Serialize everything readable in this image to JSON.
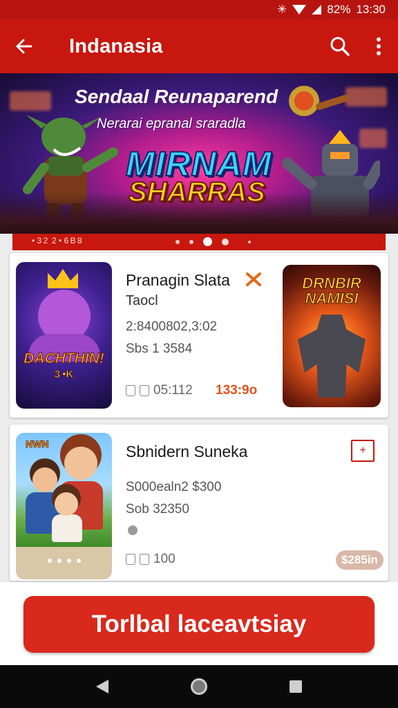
{
  "status_bar": {
    "text": "★ ▼ ▇ 82%  13:30",
    "battery": "82%",
    "time": "13:30"
  },
  "app_bar": {
    "title": "Indanasia",
    "back_icon": "arrow-left-icon",
    "search_icon": "search-icon",
    "more_icon": "more-vert-icon"
  },
  "banner": {
    "headline": "Sendaal Reunaparend",
    "subheadline": "Nerarai epranal sraradla",
    "logo_line1": "MIRNAM",
    "logo_line2": "SHARRAS",
    "caption": "• 3 2  2 • 6 B 8"
  },
  "cards": [
    {
      "thumb_label": "DACHTHIN!",
      "thumb_label2": "3 •K",
      "title_line1": "Pranagin Slata",
      "title_line2": "Taocl",
      "meta1": "2:840080‌2,3:02",
      "meta2": "Sbs 1 3584",
      "footer": "05:112",
      "price": "133:9o",
      "side_thumb_label": "DRNBIR NAMISI",
      "tag_icon": "ribbon-icon"
    },
    {
      "thumb_label": "NWN",
      "title": "Sbnidern Suneka",
      "meta1": "S000ealn2 $300",
      "meta2": "Sob 32350",
      "footer": "100",
      "price_pill": "$285in",
      "add_icon": "plus-box-icon"
    }
  ],
  "cta": {
    "label": "Torlbal laceavtsiay"
  },
  "colors": {
    "primary": "#c8170f",
    "cta": "#d9281c",
    "price": "#e0541c"
  }
}
